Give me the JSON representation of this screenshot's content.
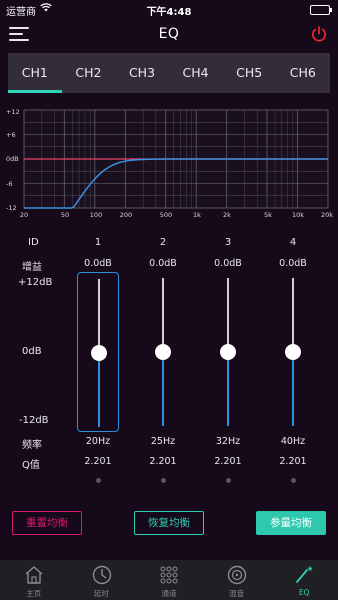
{
  "status_bar": {
    "carrier": "运营商",
    "time": "下午4:48"
  },
  "header": {
    "title": "EQ"
  },
  "channels": [
    "CH1",
    "CH2",
    "CH3",
    "CH4",
    "CH5",
    "CH6"
  ],
  "active_channel": "CH1",
  "graph": {
    "y_ticks": [
      "+12",
      "+6",
      "0dB",
      "-6",
      "-12"
    ],
    "x_ticks": [
      "20",
      "50",
      "100",
      "200",
      "500",
      "1k",
      "2k",
      "5k",
      "10k",
      "20k"
    ],
    "colors": {
      "flat": "#e8456a",
      "response": "#3a8fe0",
      "grid": "#6a6a70"
    }
  },
  "eq_table": {
    "id_label": "ID",
    "gain_label": "增益",
    "gain_max": "+12dB",
    "gain_mid": "0dB",
    "gain_min": "-12dB",
    "freq_label": "频率",
    "q_label": "Q值",
    "bands": [
      {
        "id": "1",
        "gain": "0.0dB",
        "freq": "20Hz",
        "q": "2.201",
        "level": 0.5
      },
      {
        "id": "2",
        "gain": "0.0dB",
        "freq": "25Hz",
        "q": "2.201",
        "level": 0.5
      },
      {
        "id": "3",
        "gain": "0.0dB",
        "freq": "32Hz",
        "q": "2.201",
        "level": 0.5
      },
      {
        "id": "4",
        "gain": "0.0dB",
        "freq": "40Hz",
        "q": "2.201",
        "level": 0.5
      }
    ]
  },
  "buttons": {
    "reset": "重置均衡",
    "restore": "恢复均衡",
    "param": "参量均衡"
  },
  "nav": [
    {
      "label": "主页",
      "icon": "home-icon"
    },
    {
      "label": "延时",
      "icon": "clock-icon"
    },
    {
      "label": "通道",
      "icon": "grid-dots-icon"
    },
    {
      "label": "混音",
      "icon": "disc-icon"
    },
    {
      "label": "EQ",
      "icon": "eq-wand-icon"
    }
  ],
  "accent_color": "#2ecdb3"
}
